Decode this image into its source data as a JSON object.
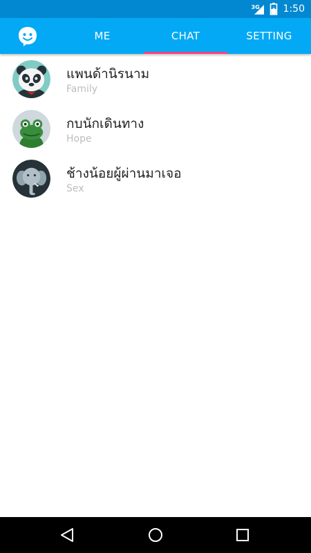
{
  "status_bar": {
    "network": "3G",
    "time": "1:50",
    "icons": [
      "signal-icon",
      "battery-icon"
    ]
  },
  "app_bar": {
    "logo_icon": "chat-face-icon",
    "tabs": [
      {
        "label": "ME",
        "selected": false
      },
      {
        "label": "CHAT",
        "selected": true
      },
      {
        "label": "SETTING",
        "selected": false
      }
    ],
    "indicator_color": "#ff4081",
    "background_color": "#03a9f4"
  },
  "chats": [
    {
      "name": "แพนด้านิรนาม",
      "subtitle": "Family",
      "avatar": "panda-avatar"
    },
    {
      "name": "กบนักเดินทาง",
      "subtitle": "Hope",
      "avatar": "frog-avatar"
    },
    {
      "name": "ช้างน้อยผู้ผ่านมาเจอ",
      "subtitle": "Sex",
      "avatar": "elephant-avatar"
    }
  ],
  "nav_bar": {
    "buttons": [
      "back-icon",
      "home-icon",
      "recents-icon"
    ]
  }
}
